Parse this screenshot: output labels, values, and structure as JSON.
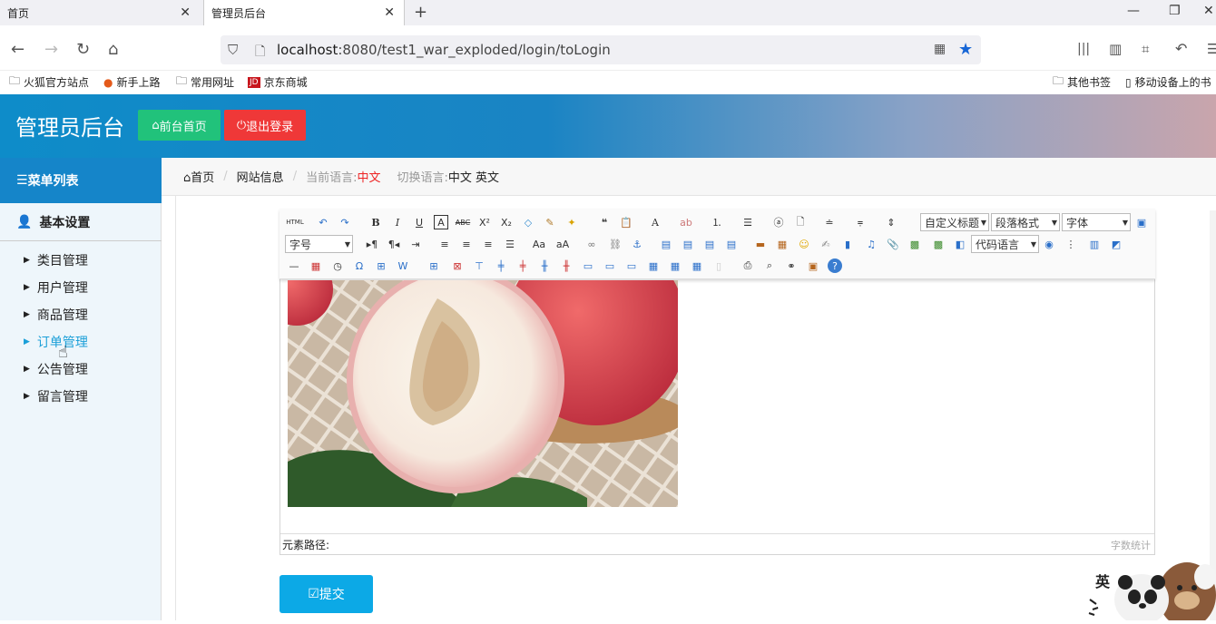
{
  "browser": {
    "tabs": [
      {
        "title": "首页"
      },
      {
        "title": "管理员后台"
      }
    ],
    "url_host": "localhost",
    "url_rest": ":8080/test1_war_exploded/login/toLogin",
    "bookmarks": [
      "火狐官方站点",
      "新手上路",
      "常用网址",
      "京东商城"
    ],
    "bookmarks_right": [
      "其他书签",
      "移动设备上的书"
    ]
  },
  "header": {
    "title": "管理员后台",
    "front_btn": "前台首页",
    "logout_btn": "退出登录"
  },
  "sidebar": {
    "head": "菜单列表",
    "section": "基本设置",
    "items": [
      {
        "label": "类目管理",
        "active": false
      },
      {
        "label": "用户管理",
        "active": false
      },
      {
        "label": "商品管理",
        "active": false
      },
      {
        "label": "订单管理",
        "active": true
      },
      {
        "label": "公告管理",
        "active": false
      },
      {
        "label": "留言管理",
        "active": false
      }
    ]
  },
  "breadcrumb": {
    "home": "首页",
    "page": "网站信息",
    "cur_lang_label": "当前语言:",
    "cur_lang": "中文",
    "switch_label": "切换语言:",
    "lang_zh": "中文",
    "lang_en": "英文"
  },
  "editor": {
    "selects": {
      "custom_title": "自定义标题",
      "paragraph": "段落格式",
      "font": "字体",
      "size": "字号",
      "code": "代码语言"
    },
    "path_label": "元素路径:",
    "word_count": "字数统计"
  },
  "submit_label": "提交",
  "ime_label": "英",
  "colors": {
    "front_btn": "#21c27b",
    "logout_btn": "#ef3838",
    "sidebar_head": "#1585c9",
    "submit": "#0ca9e6",
    "active_item": "#1a9fd8"
  }
}
